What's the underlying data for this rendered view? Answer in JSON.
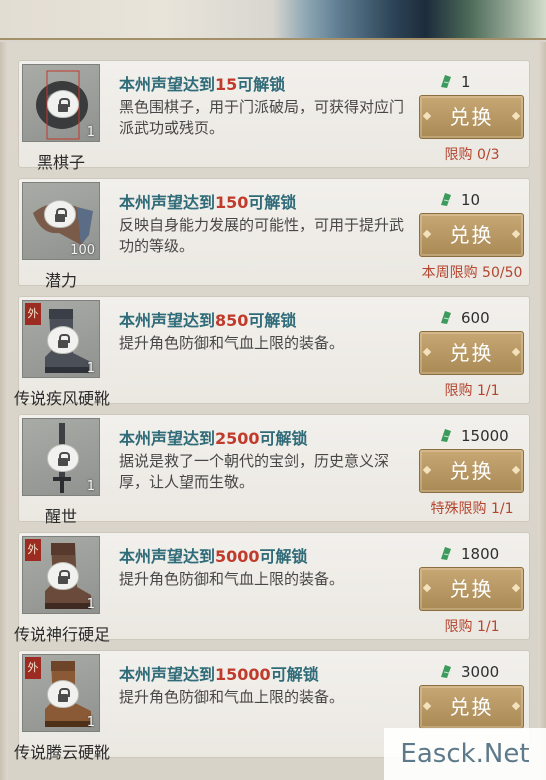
{
  "currency_icon": "jade-ticket-icon",
  "button_label": "兑换",
  "items": [
    {
      "name": "黑棋子",
      "icon": "black-go-stone-icon",
      "qty": "1",
      "tier": "",
      "unlock_prefix": "本州声望达到",
      "unlock_value": "15",
      "unlock_suffix": "可解锁",
      "desc": "黑色围棋子，用于门派破局，可获得对应门派武功或残页。",
      "price": "1",
      "limit": "限购 0/3"
    },
    {
      "name": "潜力",
      "icon": "potential-arm-icon",
      "qty": "100",
      "tier": "",
      "unlock_prefix": "本州声望达到",
      "unlock_value": "150",
      "unlock_suffix": "可解锁",
      "desc": "反映自身能力发展的可能性，可用于提升武功的等级。",
      "price": "10",
      "limit": "本周限购 50/50"
    },
    {
      "name": "传说疾风硬靴",
      "icon": "boot-icon",
      "qty": "1",
      "tier": "外",
      "unlock_prefix": "本州声望达到",
      "unlock_value": "850",
      "unlock_suffix": "可解锁",
      "desc": "提升角色防御和气血上限的装备。",
      "price": "600",
      "limit": "限购 1/1"
    },
    {
      "name": "醒世",
      "icon": "sword-icon",
      "qty": "1",
      "tier": "",
      "unlock_prefix": "本州声望达到",
      "unlock_value": "2500",
      "unlock_suffix": "可解锁",
      "desc": "据说是救了一个朝代的宝剑，历史意义深厚，让人望而生敬。",
      "price": "15000",
      "limit": "特殊限购 1/1"
    },
    {
      "name": "传说神行硬足",
      "icon": "boot-icon",
      "qty": "1",
      "tier": "外",
      "unlock_prefix": "本州声望达到",
      "unlock_value": "5000",
      "unlock_suffix": "可解锁",
      "desc": "提升角色防御和气血上限的装备。",
      "price": "1800",
      "limit": "限购 1/1"
    },
    {
      "name": "传说腾云硬靴",
      "icon": "boot-icon",
      "qty": "1",
      "tier": "外",
      "unlock_prefix": "本州声望达到",
      "unlock_value": "15000",
      "unlock_suffix": "可解锁",
      "desc": "提升角色防御和气血上限的装备。",
      "price": "3000",
      "limit": ""
    }
  ],
  "watermark": "Easck.Net"
}
